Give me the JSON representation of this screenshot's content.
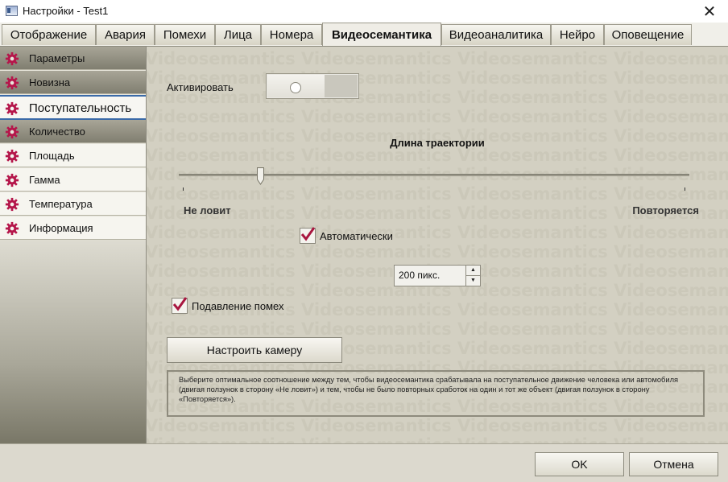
{
  "window": {
    "title": "Настройки - Test1",
    "close_glyph": "✕"
  },
  "tabs": [
    {
      "label": "Отображение",
      "active": false
    },
    {
      "label": "Авария",
      "active": false
    },
    {
      "label": "Помехи",
      "active": false
    },
    {
      "label": "Лица",
      "active": false
    },
    {
      "label": "Номера",
      "active": false
    },
    {
      "label": "Видеосемантика",
      "active": true
    },
    {
      "label": "Видеоаналитика",
      "active": false
    },
    {
      "label": "Нейро",
      "active": false
    },
    {
      "label": "Оповещение",
      "active": false
    }
  ],
  "sidebar": {
    "icon": "gear-icon",
    "icon_color": "#b5174b",
    "items": [
      {
        "label": "Параметры",
        "style": "dark"
      },
      {
        "label": "Новизна",
        "style": "dark"
      },
      {
        "label": "Поступательность",
        "style": "active"
      },
      {
        "label": "Количество",
        "style": "dark"
      },
      {
        "label": "Площадь",
        "style": "light"
      },
      {
        "label": "Гамма",
        "style": "light"
      },
      {
        "label": "Температура",
        "style": "light"
      },
      {
        "label": "Информация",
        "style": "light"
      }
    ]
  },
  "content": {
    "watermark_word": "Videosemantics",
    "activate_label": "Активировать",
    "activate_on": false,
    "slider": {
      "title": "Длина траектории",
      "min_label": "Не ловит",
      "max_label": "Повторяется",
      "position": 0.16
    },
    "auto_checkbox": {
      "label": "Автоматически",
      "checked": true
    },
    "spin": {
      "value": "200 пикс."
    },
    "noise_checkbox": {
      "label": "Подавление помех",
      "checked": true
    },
    "configure_button": "Настроить камеру",
    "hint": "Выберите оптимальное соотношение между тем, чтобы видеосемантика срабатывала на поступательное движение человека или автомобиля (двигая ползунок в сторону «Не ловит») и тем, чтобы не было повторных сработок на один и тот же объект (двигая ползунок в сторону «Повторяется»)."
  },
  "footer": {
    "ok": "OK",
    "cancel": "Отмена"
  },
  "colors": {
    "accent": "#b5174b",
    "check": "#a8163f"
  }
}
